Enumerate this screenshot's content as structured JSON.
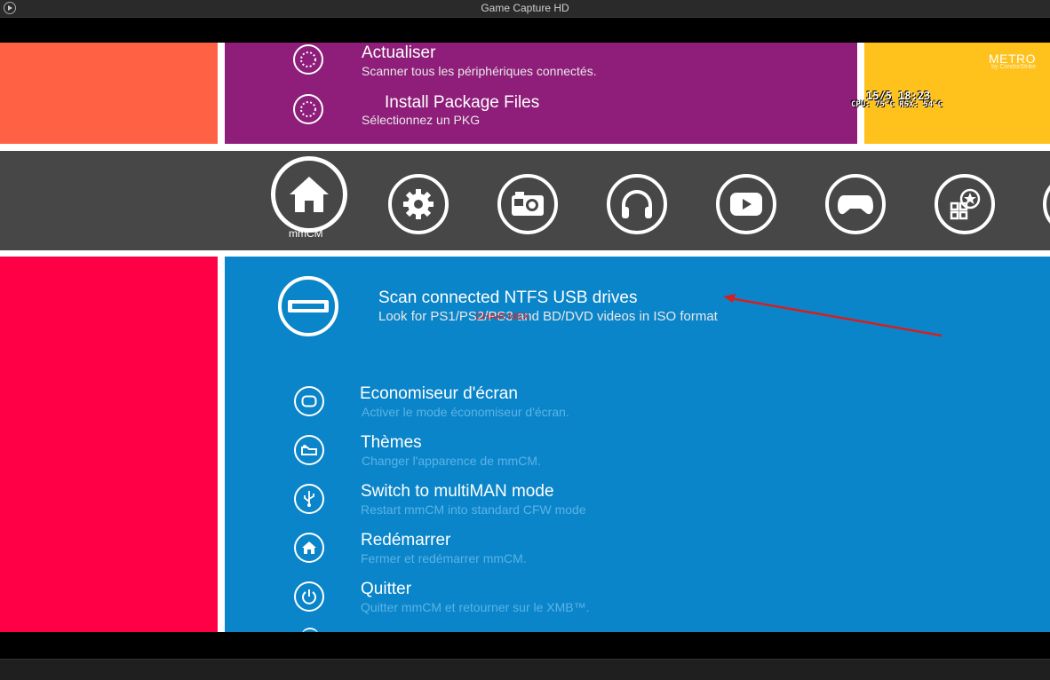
{
  "window": {
    "title": "Game Capture HD"
  },
  "top_menu": {
    "items": [
      {
        "label": "Actualiser",
        "description": "Scanner tous les périphériques connectés."
      },
      {
        "label": "Install Package Files",
        "description": "Sélectionnez un PKG"
      }
    ]
  },
  "yellow_panel": {
    "brand": "METRO",
    "brand_by": "by CondorStrike",
    "clock": "15/5 18:23",
    "temps": "CPU: 75°C RSX: 54°C"
  },
  "dock": {
    "selected_label": "mmCM",
    "icons": [
      "home-icon",
      "settings-icon",
      "camera-icon",
      "headphones-icon",
      "youtube-icon",
      "gamepad-icon",
      "apps-icon"
    ]
  },
  "main_menu": {
    "highlighted": {
      "label": "Scan connected NTFS USB drives",
      "description": "Look for PS1/PS2/PS3 and BD/DVD videos in ISO format"
    },
    "overlay_text": "CHAIR MEX",
    "items": [
      {
        "label": "Economiseur d'écran",
        "description": "Activer le mode économiseur d'écran."
      },
      {
        "label": "Thèmes",
        "description": "Changer l'apparence de mmCM."
      },
      {
        "label": "Switch to multiMAN mode",
        "description": "Restart mmCM into standard CFW mode"
      },
      {
        "label": "Redémarrer",
        "description": "Fermer et redémarrer mmCM."
      },
      {
        "label": "Quitter",
        "description": "Quitter mmCM et retourner sur le XMB™."
      }
    ]
  },
  "colors": {
    "orange": "#ff6145",
    "purple": "#8e1e79",
    "yellow": "#ffc21c",
    "dock": "#474747",
    "pink": "#ff0047",
    "blue": "#0b85c9",
    "arrow": "#d32020"
  }
}
